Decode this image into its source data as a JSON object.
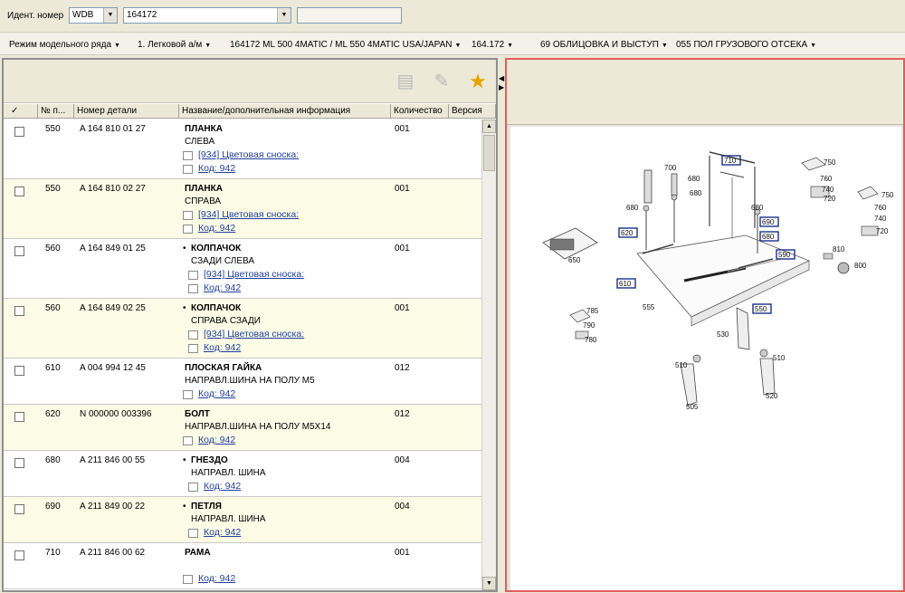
{
  "header": {
    "ident_label": "Идент. номер",
    "ident_type": "WDB",
    "ident_value": "164172",
    "extra_value": ""
  },
  "breadcrumbs": [
    "Режим модельного ряда",
    "1. Легковой а/м",
    "164172 ML 500 4MATIC / ML 550 4MATIC USA/JAPAN",
    "164.172",
    "69 ОБЛИЦОВКА И ВЫСТУП",
    "055 ПОЛ ГРУЗОВОГО ОТСЕКА"
  ],
  "toolbar": {
    "icons": [
      "copy-icon",
      "edit-icon",
      "star-icon"
    ]
  },
  "table": {
    "columns": [
      "✓",
      "№ п...",
      "Номер детали",
      "Название/дополнительная информация",
      "Количество",
      "Версия"
    ],
    "rows": [
      {
        "pos": "550",
        "part": "A 164 810 01 27",
        "name": "ПЛАНКА",
        "bullet": false,
        "desc": "СЛЕВА",
        "qty": "001",
        "links": [
          "[934] Цветовая сноска:",
          "Код: 942"
        ]
      },
      {
        "pos": "550",
        "part": "A 164 810 02 27",
        "name": "ПЛАНКА",
        "bullet": false,
        "desc": "СПРАВА",
        "qty": "001",
        "links": [
          "[934] Цветовая сноска:",
          "Код: 942"
        ]
      },
      {
        "pos": "560",
        "part": "A 164 849 01 25",
        "name": "КОЛПАЧОК",
        "bullet": true,
        "desc": "СЗАДИ СЛЕВА",
        "qty": "001",
        "links": [
          "[934] Цветовая сноска:",
          "Код: 942"
        ]
      },
      {
        "pos": "560",
        "part": "A 164 849 02 25",
        "name": "КОЛПАЧОК",
        "bullet": true,
        "desc": "СПРАВА СЗАДИ",
        "qty": "001",
        "links": [
          "[934] Цветовая сноска:",
          "Код: 942"
        ]
      },
      {
        "pos": "610",
        "part": "A 004 994 12 45",
        "name": "ПЛОСКАЯ ГАЙКА",
        "bullet": false,
        "desc": "НАПРАВЛ.ШИНА НА ПОЛУ М5",
        "qty": "012",
        "links": [
          "Код: 942"
        ]
      },
      {
        "pos": "620",
        "part": "N 000000 003396",
        "name": "БОЛТ",
        "bullet": false,
        "desc": "НАПРАВЛ.ШИНА НА ПОЛУ М5Х14",
        "qty": "012",
        "links": [
          "Код: 942"
        ]
      },
      {
        "pos": "680",
        "part": "A 211 846 00 55",
        "name": "ГНЕЗДО",
        "bullet": true,
        "desc": "НАПРАВЛ. ШИНА",
        "qty": "004",
        "links": [
          "Код: 942"
        ]
      },
      {
        "pos": "690",
        "part": "A 211 849 00 22",
        "name": "ПЕТЛЯ",
        "bullet": true,
        "desc": "НАПРАВЛ. ШИНА",
        "qty": "004",
        "links": [
          "Код: 942"
        ]
      },
      {
        "pos": "710",
        "part": "A 211 846 00 62",
        "name": "РАМА",
        "bullet": false,
        "desc": "",
        "qty": "001",
        "links": [
          "Код: 942"
        ]
      }
    ]
  },
  "diagram": {
    "callouts": [
      "700",
      "710",
      "680",
      "680",
      "680",
      "680",
      "690",
      "680",
      "620",
      "590",
      "610",
      "555",
      "550",
      "650",
      "750",
      "760",
      "740",
      "720",
      "750",
      "760",
      "740",
      "720",
      "810",
      "800",
      "785",
      "790",
      "780",
      "530",
      "510",
      "505",
      "510",
      "520"
    ]
  }
}
